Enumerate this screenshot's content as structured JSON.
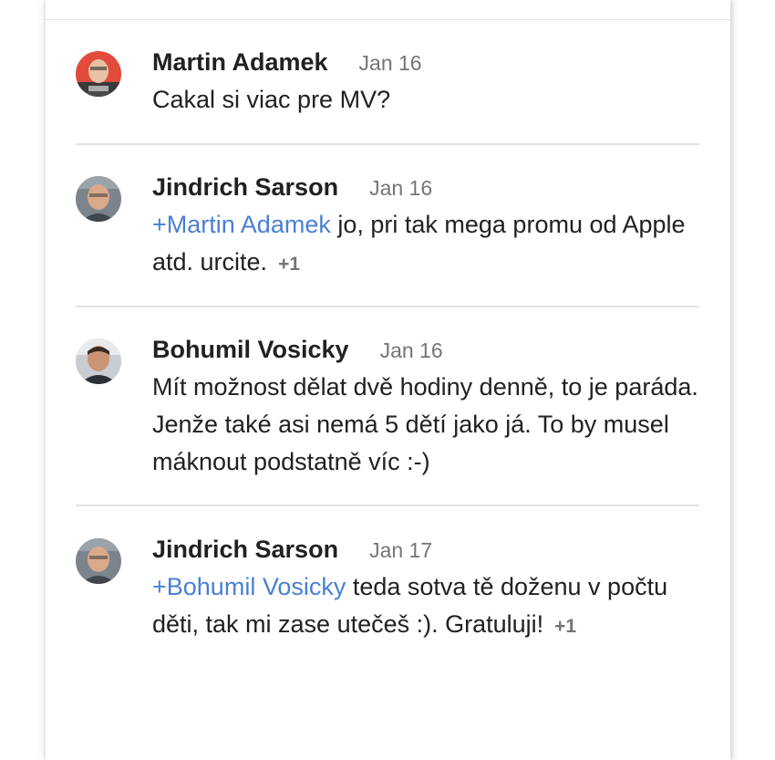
{
  "comments": [
    {
      "author": "Martin Adamek",
      "date": "Jan 16",
      "mention": "",
      "text": "Cakal si viac pre MV?",
      "plus_one": "",
      "avatar_icon": "avatar-photo",
      "avatar_color": "#e05545"
    },
    {
      "author": "Jindrich Sarson",
      "date": "Jan 16",
      "mention": "+Martin Adamek",
      "text": " jo, pri tak mega promu od Apple atd. urcite.",
      "plus_one": "+1",
      "avatar_icon": "avatar-photo",
      "avatar_color": "#6f7780"
    },
    {
      "author": "Bohumil Vosicky",
      "date": "Jan 16",
      "mention": "",
      "text": "Mít možnost dělat dvě hodiny denně, to je paráda. Jenže také asi nemá 5 dětí jako já. To by musel máknout podstatně víc :-)",
      "plus_one": "",
      "avatar_icon": "avatar-photo",
      "avatar_color": "#5a5a5a"
    },
    {
      "author": "Jindrich Sarson",
      "date": "Jan 17",
      "mention": "+Bohumil Vosicky",
      "text": " teda sotva tě doženu v počtu děti, tak mi zase utečeš :). Gratuluji!",
      "plus_one": "+1",
      "avatar_icon": "avatar-photo",
      "avatar_color": "#6f7780"
    }
  ],
  "colors": {
    "mention": "#4a7fd6",
    "author": "#212121",
    "date": "#757575",
    "divider": "#e3e3e3"
  }
}
